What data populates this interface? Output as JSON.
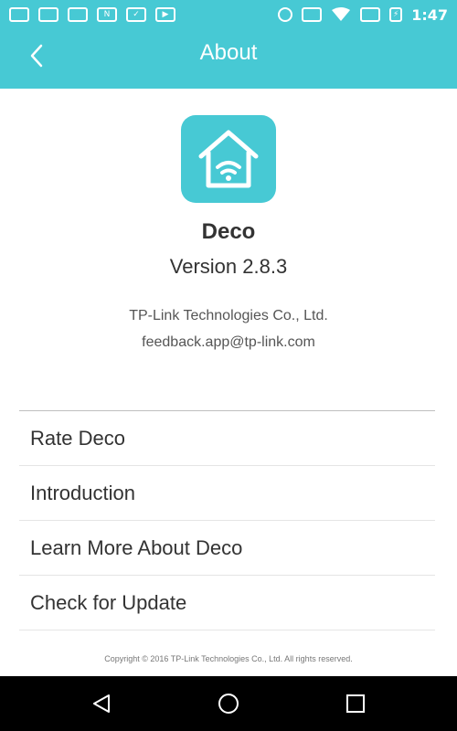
{
  "status_bar": {
    "left_icons": [
      "sim-icon",
      "photo-icon",
      "photo-icon",
      "n-icon",
      "check-icon",
      "video-icon"
    ],
    "right_icons": [
      "location-icon",
      "vibrate-icon",
      "wifi-icon",
      "no-signal-icon",
      "battery-charging-icon"
    ],
    "time": "1:47"
  },
  "app_bar": {
    "title": "About"
  },
  "app_info": {
    "logo": "home-wifi-icon",
    "name": "Deco",
    "version_label": "Version",
    "version_value": "2.8.3",
    "company": "TP-Link Technologies Co., Ltd.",
    "email": "feedback.app@tp-link.com"
  },
  "menu": {
    "items": [
      {
        "label": "Rate Deco"
      },
      {
        "label": "Introduction"
      },
      {
        "label": "Learn More About Deco"
      },
      {
        "label": "Check for Update"
      }
    ]
  },
  "footer": {
    "copyright": "Copyright © 2016 TP-Link Technologies Co., Ltd. All rights reserved."
  },
  "nav_bar": {
    "buttons": [
      "back-nav-icon",
      "home-nav-icon",
      "recents-nav-icon"
    ]
  },
  "colors": {
    "accent": "#47c9d4",
    "text": "#333333",
    "divider": "#e5e5e5"
  }
}
